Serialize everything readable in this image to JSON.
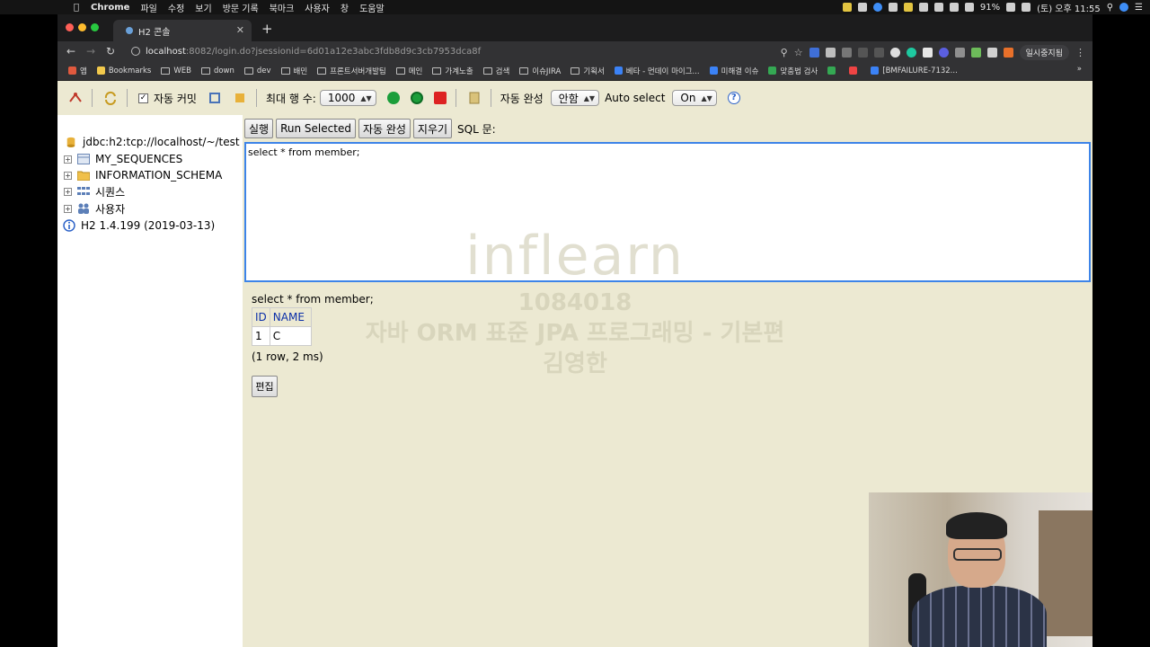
{
  "menubar": {
    "app": "Chrome",
    "items": [
      "파일",
      "수정",
      "보기",
      "방문 기록",
      "북마크",
      "사용자",
      "창",
      "도움말"
    ],
    "battery": "91%",
    "clock": "(토) 오후 11:55"
  },
  "browser": {
    "tab_title": "H2 콘솔",
    "url_host": "localhost",
    "url_rest": ":8082/login.do?jsessionid=6d01a12e3abc3fdb8d9c3cb7953dca8f",
    "profile_label": "일시중지됨",
    "bookmarks": [
      {
        "label": "앱",
        "color": "#e0593e"
      },
      {
        "label": "Bookmarks",
        "color": "#f2c94c"
      },
      {
        "label": "WEB",
        "folder": true
      },
      {
        "label": "down",
        "folder": true
      },
      {
        "label": "dev",
        "folder": true
      },
      {
        "label": "배민",
        "folder": true
      },
      {
        "label": "프론트서버개발팀",
        "folder": true
      },
      {
        "label": "메인",
        "folder": true
      },
      {
        "label": "가계노출",
        "folder": true
      },
      {
        "label": "검색",
        "folder": true
      },
      {
        "label": "이슈JIRA",
        "folder": true
      },
      {
        "label": "기획서",
        "folder": true
      },
      {
        "label": "베타 - 먼데이 마이그...",
        "color": "#3b82f6"
      },
      {
        "label": "미해결 이슈",
        "color": "#3b82f6"
      },
      {
        "label": "맞춤법 검사",
        "color": "#34a853"
      },
      {
        "label": "",
        "color": "#34a853"
      },
      {
        "label": "",
        "color": "#ef4444"
      },
      {
        "label": "[BMFAILURE-7132...",
        "color": "#3b82f6"
      }
    ]
  },
  "toolbar": {
    "autocommit_label": "자동 커밋",
    "max_rows_label": "최대 행 수:",
    "max_rows_value": "1000",
    "autocomplete_label": "자동 완성",
    "autocomplete_value": "안함",
    "autoselect_label": "Auto select",
    "autoselect_value": "On",
    "help_label": "?"
  },
  "tree": {
    "connection": "jdbc:h2:tcp://localhost/~/test",
    "items": [
      "MY_SEQUENCES",
      "INFORMATION_SCHEMA",
      "시퀀스",
      "사용자"
    ],
    "version": "H2 1.4.199 (2019-03-13)"
  },
  "editor": {
    "run": "실행",
    "run_selected": "Run Selected",
    "autocomplete": "자동 완성",
    "clear": "지우기",
    "sql_label": "SQL 문:",
    "sql": "select * from member;"
  },
  "result": {
    "query": "select * from member;",
    "columns": [
      "ID",
      "NAME"
    ],
    "rows": [
      [
        "1",
        "C"
      ]
    ],
    "info": "(1 row, 2 ms)",
    "edit_button": "편집"
  },
  "watermark": {
    "brand": "inflearn",
    "code": "1084018",
    "course": "자바 ORM 표준 JPA 프로그래밍 - 기본편",
    "author": "김영한"
  }
}
